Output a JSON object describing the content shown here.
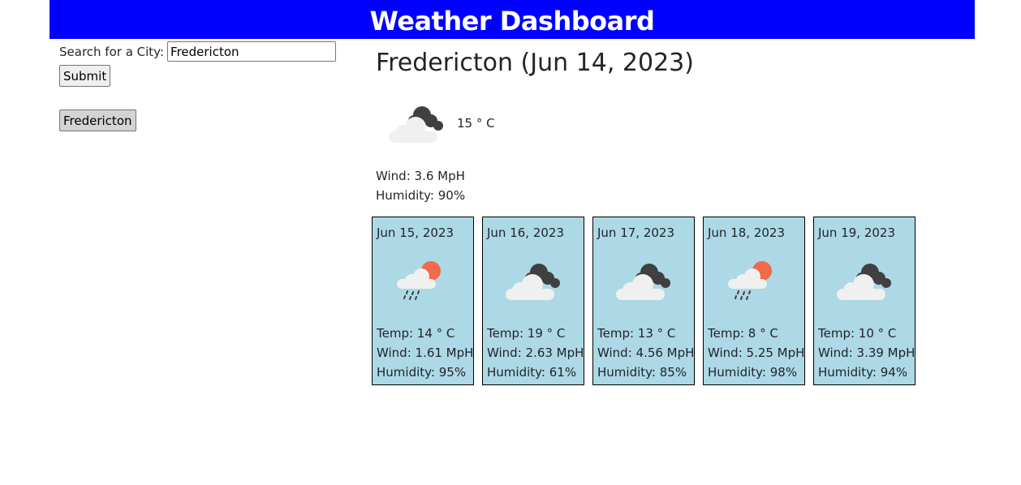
{
  "header": {
    "title": "Weather Dashboard",
    "bg_color": "#0000ff"
  },
  "search": {
    "label": "Search for a City:",
    "value": "Fredericton",
    "submit_label": "Submit"
  },
  "history": {
    "items": [
      "Fredericton"
    ]
  },
  "current": {
    "title": "Fredericton (Jun 14, 2023)",
    "icon": "broken-clouds-icon",
    "temp": "15 ° C",
    "wind": "Wind: 3.6 MpH",
    "humidity": "Humidity: 90%"
  },
  "forecast": [
    {
      "date": "Jun 15, 2023",
      "icon": "light-rain-icon",
      "temp": "Temp: 14 ° C",
      "wind": "Wind: 1.61 MpH",
      "humidity": "Humidity: 95%"
    },
    {
      "date": "Jun 16, 2023",
      "icon": "broken-clouds-icon",
      "temp": "Temp: 19 ° C",
      "wind": "Wind: 2.63 MpH",
      "humidity": "Humidity: 61%"
    },
    {
      "date": "Jun 17, 2023",
      "icon": "broken-clouds-icon",
      "temp": "Temp: 13 ° C",
      "wind": "Wind: 4.56 MpH",
      "humidity": "Humidity: 85%"
    },
    {
      "date": "Jun 18, 2023",
      "icon": "light-rain-icon",
      "temp": "Temp: 8 ° C",
      "wind": "Wind: 5.25 MpH",
      "humidity": "Humidity: 98%"
    },
    {
      "date": "Jun 19, 2023",
      "icon": "broken-clouds-icon",
      "temp": "Temp: 10 ° C",
      "wind": "Wind: 3.39 MpH",
      "humidity": "Humidity: 94%"
    }
  ],
  "colors": {
    "forecast_card_bg": "#add8e6",
    "sun": "#f06b4a",
    "dark_cloud": "#404040",
    "light_cloud": "#f0f0f0"
  }
}
